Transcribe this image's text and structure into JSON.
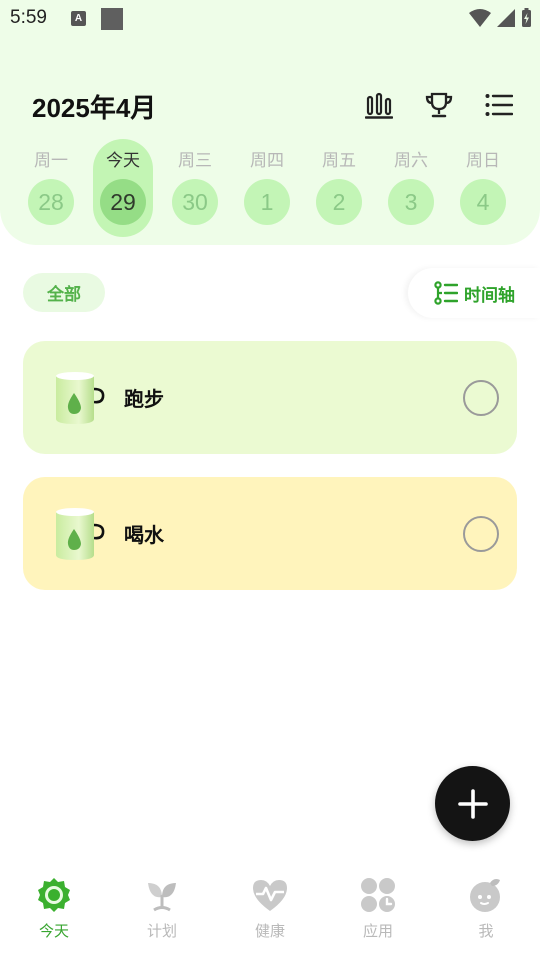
{
  "status_bar": {
    "time": "5:59",
    "notification_badge": "A"
  },
  "header": {
    "month_title": "2025年4月",
    "icons": [
      "stats-icon",
      "trophy-icon",
      "list-icon"
    ]
  },
  "week": [
    {
      "label": "周一",
      "day": "28",
      "today": false
    },
    {
      "label": "今天",
      "day": "29",
      "today": true
    },
    {
      "label": "周三",
      "day": "30",
      "today": false
    },
    {
      "label": "周四",
      "day": "1",
      "today": false
    },
    {
      "label": "周五",
      "day": "2",
      "today": false
    },
    {
      "label": "周六",
      "day": "3",
      "today": false
    },
    {
      "label": "周日",
      "day": "4",
      "today": false
    }
  ],
  "filter": {
    "all_label": "全部",
    "timeline_label": "时间轴"
  },
  "tasks": [
    {
      "name": "跑步",
      "done": false,
      "color": "#ebfad2"
    },
    {
      "name": "喝水",
      "done": false,
      "color": "#fff4bc"
    }
  ],
  "bottom_nav": [
    {
      "label": "今天",
      "icon": "sun-icon",
      "active": true
    },
    {
      "label": "计划",
      "icon": "sprout-icon",
      "active": false
    },
    {
      "label": "健康",
      "icon": "heart-pulse-icon",
      "active": false
    },
    {
      "label": "应用",
      "icon": "apps-icon",
      "active": false
    },
    {
      "label": "我",
      "icon": "profile-icon",
      "active": false
    }
  ],
  "colors": {
    "accent": "#38a530",
    "header_bg": "#eefde8",
    "day_circle": "#c3f5b6",
    "today_circle": "#95dd86"
  }
}
